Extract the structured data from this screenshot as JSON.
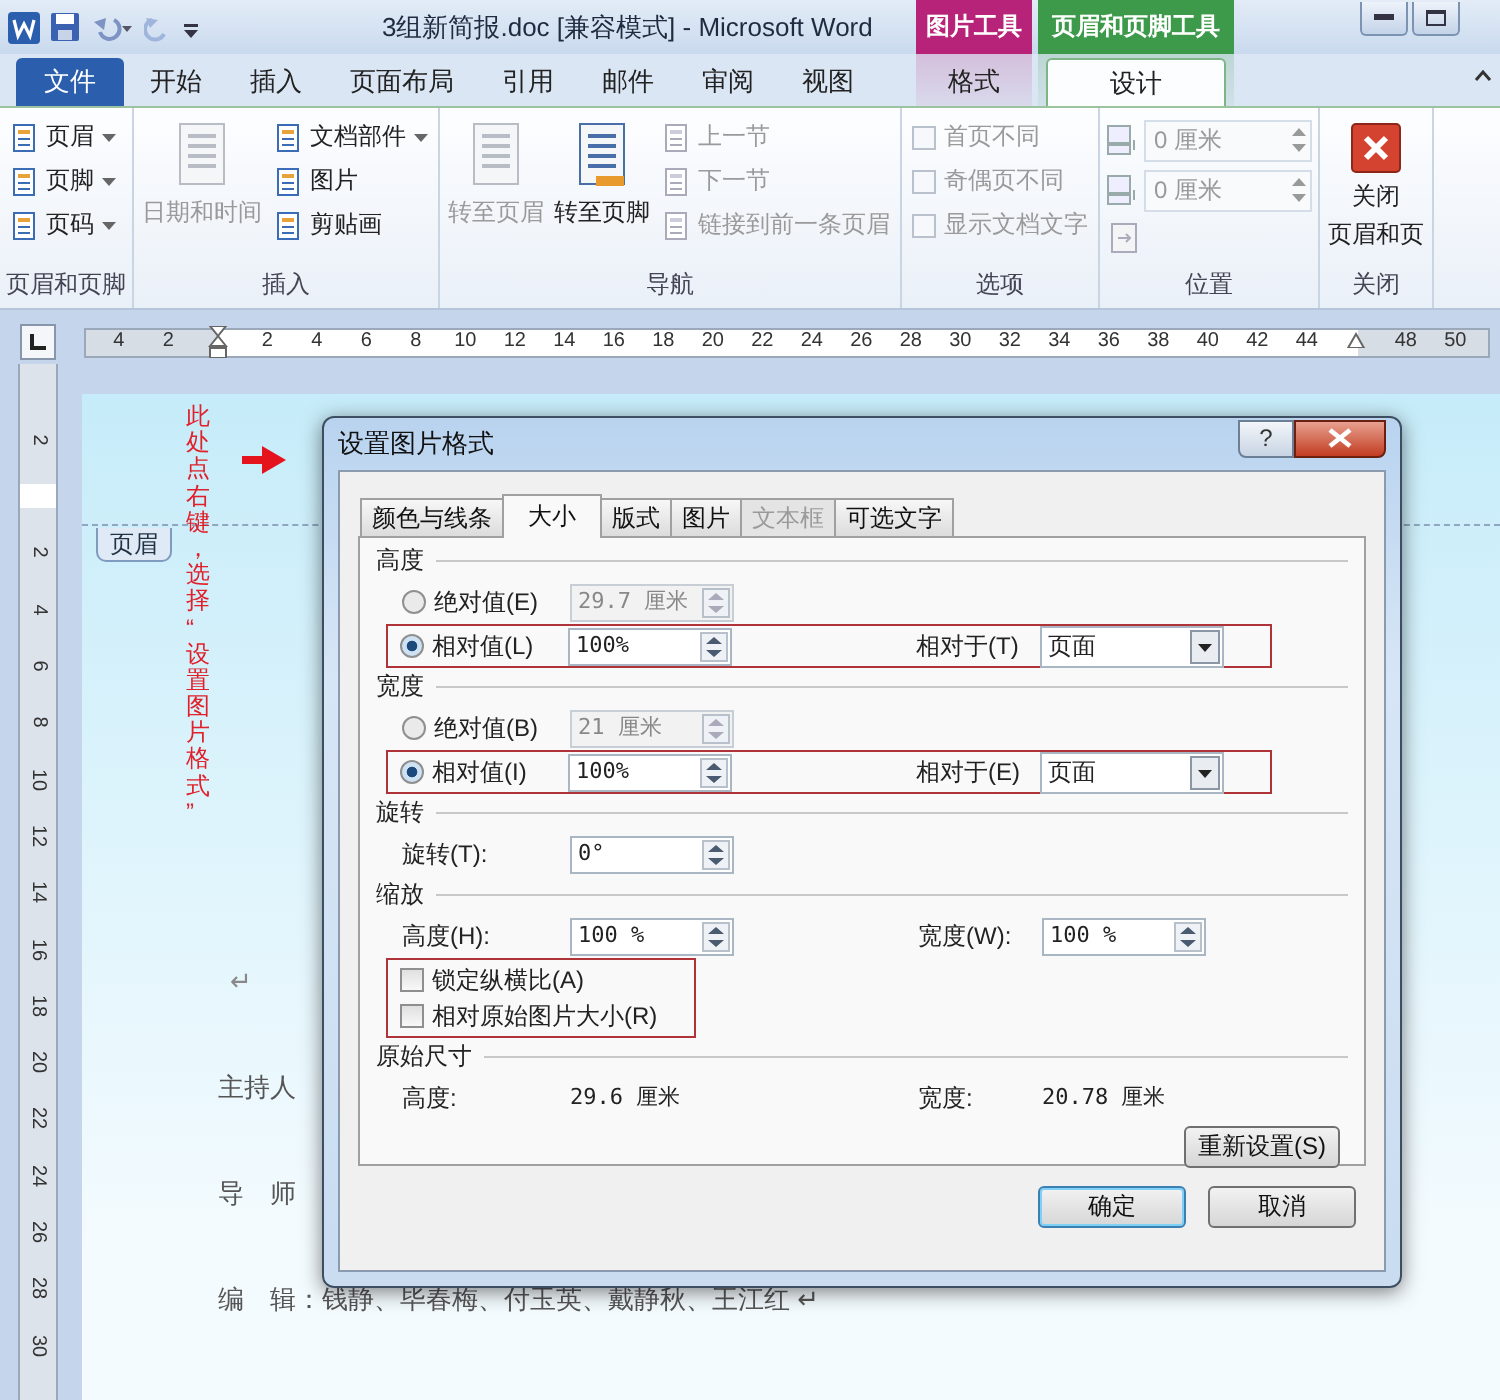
{
  "window": {
    "title": "3组新简报.doc [兼容模式] - Microsoft Word"
  },
  "file_tab": {
    "label": "文件"
  },
  "tabs": [
    {
      "label": "开始",
      "selected": false
    },
    {
      "label": "插入",
      "selected": false
    },
    {
      "label": "页面布局",
      "selected": false
    },
    {
      "label": "引用",
      "selected": false
    },
    {
      "label": "邮件",
      "selected": false
    },
    {
      "label": "审阅",
      "selected": false
    },
    {
      "label": "视图",
      "selected": false
    }
  ],
  "context_tabs": [
    {
      "label": "图片工具",
      "color": "#b8237a",
      "tabs": [
        {
          "label": "格式",
          "selected": false
        }
      ]
    },
    {
      "label": "页眉和页脚工具",
      "color": "#3c9a4a",
      "tabs": [
        {
          "label": "设计",
          "selected": true
        }
      ]
    }
  ],
  "ribbon_groups": [
    {
      "label": "页眉和页脚",
      "items": [
        {
          "kind": "small",
          "label": "页眉",
          "dropdown": true,
          "disabled": false
        },
        {
          "kind": "small",
          "label": "页脚",
          "dropdown": true,
          "disabled": false
        },
        {
          "kind": "small",
          "label": "页码",
          "dropdown": true,
          "disabled": false
        }
      ]
    },
    {
      "label": "插入",
      "items": [
        {
          "kind": "large",
          "label": "日期和时间",
          "disabled": true
        },
        {
          "kind": "small",
          "label": "文档部件",
          "dropdown": true,
          "disabled": false
        },
        {
          "kind": "small",
          "label": "图片",
          "dropdown": false,
          "disabled": false
        },
        {
          "kind": "small",
          "label": "剪贴画",
          "dropdown": false,
          "disabled": false
        }
      ]
    },
    {
      "label": "导航",
      "items": [
        {
          "kind": "large",
          "label": "转至页眉",
          "disabled": true
        },
        {
          "kind": "large",
          "label": "转至页脚",
          "disabled": false
        },
        {
          "kind": "small",
          "label": "上一节",
          "dropdown": false,
          "disabled": true
        },
        {
          "kind": "small",
          "label": "下一节",
          "dropdown": false,
          "disabled": true
        },
        {
          "kind": "small",
          "label": "链接到前一条页眉",
          "dropdown": false,
          "disabled": true
        }
      ]
    },
    {
      "label": "选项",
      "items": [
        {
          "kind": "checkbox",
          "label": "首页不同",
          "checked": false,
          "disabled": true
        },
        {
          "kind": "checkbox",
          "label": "奇偶页不同",
          "checked": false,
          "disabled": true
        },
        {
          "kind": "checkbox",
          "label": "显示文档文字",
          "checked": false,
          "disabled": true
        }
      ]
    },
    {
      "label": "位置",
      "items": [
        {
          "kind": "spin",
          "value": "0 厘米",
          "disabled": true
        },
        {
          "kind": "spin",
          "value": "0 厘米",
          "disabled": true
        },
        {
          "kind": "tool",
          "disabled": true
        }
      ]
    },
    {
      "label": "关闭",
      "items": [
        {
          "kind": "close",
          "label_lines": [
            "关闭",
            "页眉和页"
          ],
          "disabled": false
        }
      ]
    }
  ],
  "ruler": {
    "left_ticks": [
      "4",
      "2"
    ],
    "ticks": [
      "2",
      "4",
      "6",
      "8",
      "10",
      "12",
      "14",
      "16",
      "18",
      "20",
      "22",
      "24",
      "26",
      "28",
      "30",
      "32",
      "34",
      "36",
      "38",
      "40",
      "42",
      "44"
    ],
    "right_ticks": [
      "48",
      "50"
    ]
  },
  "vertical_ruler": {
    "top_ticks": [
      "2"
    ],
    "ticks": [
      "2",
      "4",
      "6",
      "8",
      "10",
      "12",
      "14",
      "16",
      "18",
      "20",
      "22",
      "24",
      "26",
      "28",
      "30"
    ]
  },
  "document": {
    "annotation": "此处点右键，选择“设置图片格式”",
    "header_tag": "页眉",
    "lines": [
      {
        "kind": "mark",
        "text": "↵"
      },
      {
        "kind": "text",
        "text": "主持人"
      },
      {
        "kind": "text",
        "text": "导　师"
      },
      {
        "kind": "text",
        "text": "编　辑：钱静、毕春梅、付玉英、戴静秋、王江红 ↵"
      }
    ]
  },
  "dialog": {
    "title": "设置图片格式",
    "help_button": "?",
    "tabs": [
      {
        "label": "颜色与线条",
        "selected": false,
        "disabled": false
      },
      {
        "label": "大小",
        "selected": true,
        "disabled": false
      },
      {
        "label": "版式",
        "selected": false,
        "disabled": false
      },
      {
        "label": "图片",
        "selected": false,
        "disabled": false
      },
      {
        "label": "文本框",
        "selected": false,
        "disabled": true
      },
      {
        "label": "可选文字",
        "selected": false,
        "disabled": false
      }
    ],
    "sections": [
      {
        "title": "高度",
        "rows": [
          {
            "kind": "radio",
            "label": "绝对值(E)",
            "selected": false,
            "value": "29.7 厘米",
            "disabled": true,
            "highlighted": false
          },
          {
            "kind": "radio",
            "label": "相对值(L)",
            "selected": true,
            "value": "100%",
            "disabled": false,
            "highlighted": true,
            "relative_label": "相对于(T)",
            "relative_value": "页面"
          }
        ]
      },
      {
        "title": "宽度",
        "rows": [
          {
            "kind": "radio",
            "label": "绝对值(B)",
            "selected": false,
            "value": "21 厘米",
            "disabled": true,
            "highlighted": false
          },
          {
            "kind": "radio",
            "label": "相对值(I)",
            "selected": true,
            "value": "100%",
            "disabled": false,
            "highlighted": true,
            "relative_label": "相对于(E)",
            "relative_value": "页面"
          }
        ]
      },
      {
        "title": "旋转",
        "rows": [
          {
            "kind": "spin",
            "label": "旋转(T):",
            "value": "0°"
          }
        ]
      },
      {
        "title": "缩放",
        "rows": [
          {
            "kind": "spin_pair",
            "label": "高度(H):",
            "value": "100 %",
            "label2": "宽度(W):",
            "value2": "100 %"
          },
          {
            "kind": "checkboxes",
            "highlighted": true,
            "items": [
              {
                "label": "锁定纵横比(A)",
                "checked": false
              },
              {
                "label": "相对原始图片大小(R)",
                "checked": false
              }
            ]
          }
        ]
      },
      {
        "title": "原始尺寸",
        "rows": [
          {
            "kind": "info",
            "label": "高度:",
            "value": "29.6 厘米",
            "label2": "宽度:",
            "value2": "20.78 厘米"
          }
        ]
      }
    ],
    "reset_button": "重新设置(S)",
    "ok_button": "确定",
    "cancel_button": "取消"
  }
}
